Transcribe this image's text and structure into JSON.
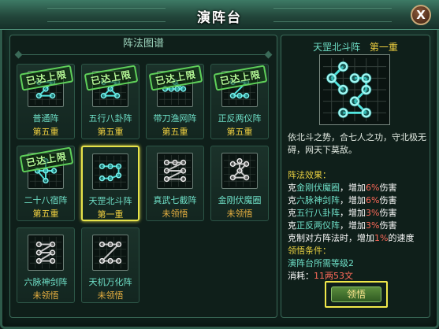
{
  "window": {
    "title": "演阵台",
    "close_label": "X"
  },
  "left_panel": {
    "header": "阵法图谱",
    "stamp_text": "已达上限",
    "cells": [
      {
        "name": "普通阵",
        "level": "第五重",
        "maxed": true,
        "state": "learned",
        "pattern": "dots"
      },
      {
        "name": "五行八卦阵",
        "level": "第五重",
        "maxed": true,
        "state": "learned",
        "pattern": "ring"
      },
      {
        "name": "带刀渔网阵",
        "level": "第五重",
        "maxed": true,
        "state": "learned",
        "pattern": "line"
      },
      {
        "name": "正反两仪阵",
        "level": "第五重",
        "maxed": true,
        "state": "learned",
        "pattern": "pair"
      },
      {
        "name": "二十八宿阵",
        "level": "第五重",
        "maxed": true,
        "state": "learned",
        "pattern": "cross"
      },
      {
        "name": "天罡北斗阵",
        "level": "第一重",
        "maxed": false,
        "state": "selected",
        "pattern": "dipper"
      },
      {
        "name": "真武七截阵",
        "level": "未领悟",
        "maxed": false,
        "state": "unlearned",
        "pattern": "seven"
      },
      {
        "name": "金刚伏魔圈",
        "level": "未领悟",
        "maxed": false,
        "state": "unlearned",
        "pattern": "circle"
      },
      {
        "name": "六脉神剑阵",
        "level": "未领悟",
        "maxed": false,
        "state": "unlearned",
        "pattern": "six"
      },
      {
        "name": "天机万化阵",
        "level": "未领悟",
        "maxed": false,
        "state": "unlearned",
        "pattern": "grid"
      }
    ]
  },
  "detail": {
    "name": "天罡北斗阵",
    "level": "第一重",
    "description": "依北斗之势，合七人之功，守北极无碍，网天下莫敌。",
    "effect_label": "阵法效果：",
    "effects": [
      {
        "prefix": "克",
        "target": "金刚伏魔圈",
        "mid": "，增加",
        "pct": "6%",
        "suffix": "伤害"
      },
      {
        "prefix": "克",
        "target": "六脉神剑阵",
        "mid": "，增加",
        "pct": "6%",
        "suffix": "伤害"
      },
      {
        "prefix": "克",
        "target": "五行八卦阵",
        "mid": "，增加",
        "pct": "3%",
        "suffix": "伤害"
      },
      {
        "prefix": "克",
        "target": "正反两仪阵",
        "mid": "，增加",
        "pct": "3%",
        "suffix": "伤害"
      }
    ],
    "counter_text_a": "克制对方阵法时，增加",
    "counter_pct": "1%",
    "counter_text_b": "的速度",
    "req_label": "领悟条件：",
    "req_text": "演阵台所需等级2",
    "cost_label": "消耗：",
    "cost_value": "11两53文",
    "learn_button": "领悟"
  },
  "colors": {
    "accent_cyan": "#6fe0c8",
    "gold": "#f0d040",
    "highlight_yellow": "#e7e34a",
    "red_number": "#ff6a5a",
    "stamp_green": "#5fd05a"
  }
}
